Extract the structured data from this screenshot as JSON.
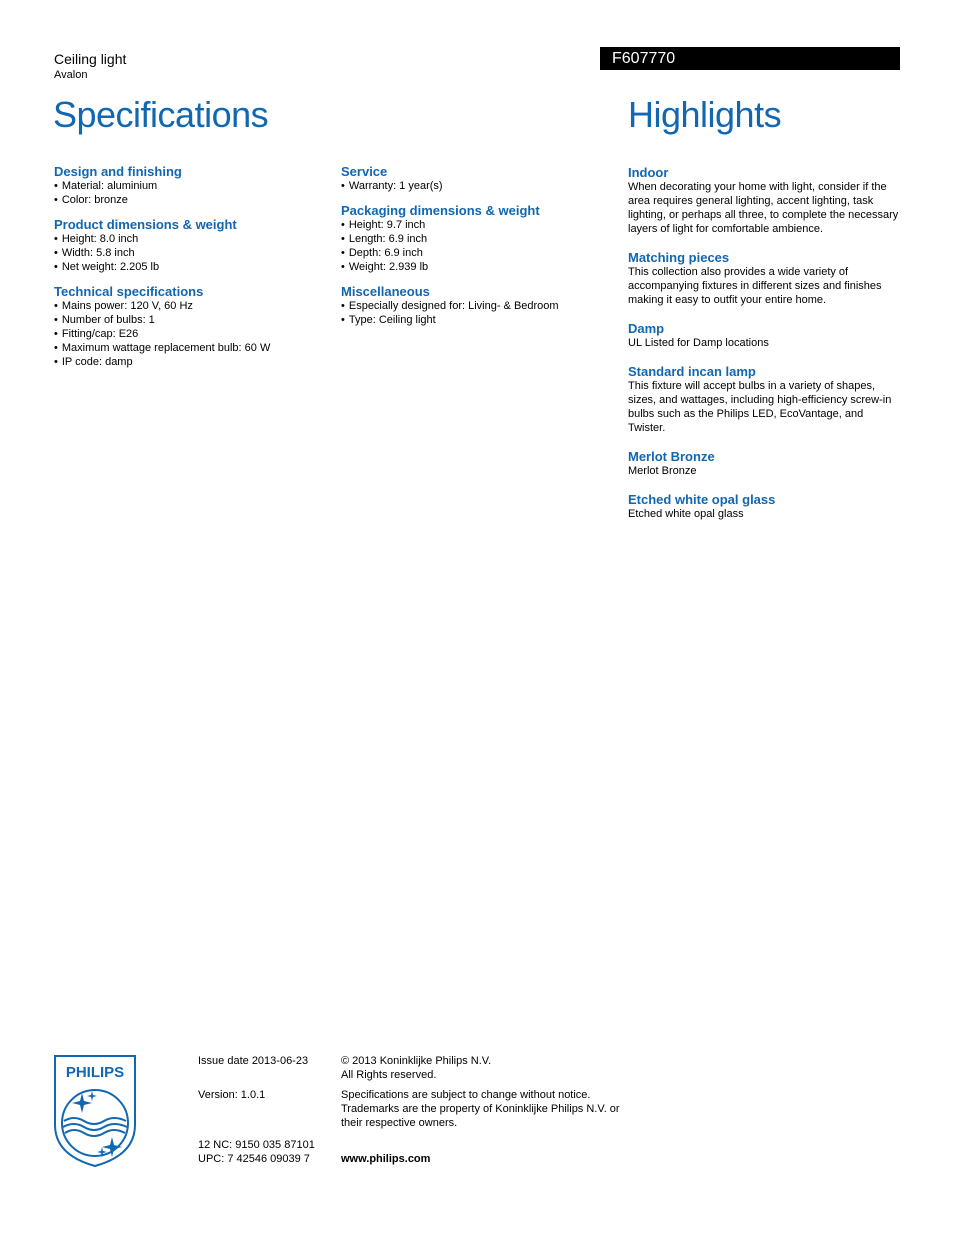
{
  "header": {
    "product_type": "Ceiling light",
    "product_family": "Avalon",
    "product_code": "F607770",
    "specs_title": "Specifications",
    "highlights_title": "Highlights"
  },
  "specifications": {
    "column1": [
      {
        "title": "Design and finishing",
        "items": [
          "Material: aluminium",
          "Color: bronze"
        ]
      },
      {
        "title": "Product dimensions & weight",
        "items": [
          "Height: 8.0 inch",
          "Width: 5.8 inch",
          "Net weight: 2.205 lb"
        ]
      },
      {
        "title": "Technical specifications",
        "items": [
          "Mains power: 120 V, 60 Hz",
          "Number of bulbs: 1",
          "Fitting/cap: E26",
          "Maximum wattage replacement bulb: 60 W",
          "IP code: damp"
        ]
      }
    ],
    "column2": [
      {
        "title": "Service",
        "items": [
          "Warranty: 1 year(s)"
        ]
      },
      {
        "title": "Packaging dimensions & weight",
        "items": [
          "Height: 9.7 inch",
          "Length: 6.9 inch",
          "Depth: 6.9 inch",
          "Weight: 2.939 lb"
        ]
      },
      {
        "title": "Miscellaneous",
        "items": [
          "Especially designed for: Living- & Bedroom",
          "Type: Ceiling light"
        ]
      }
    ]
  },
  "highlights": [
    {
      "title": "Indoor",
      "text": "When decorating your home with light, consider if the area requires general lighting, accent lighting, task lighting, or perhaps all three, to complete the necessary layers of light for comfortable ambience."
    },
    {
      "title": "Matching pieces",
      "text": "This collection also provides a wide variety of accompanying fixtures in different sizes and finishes making it easy to outfit your entire home."
    },
    {
      "title": "Damp",
      "text": "UL Listed for Damp locations"
    },
    {
      "title": "Standard incan lamp",
      "text": "This fixture will accept bulbs in a variety of shapes, sizes, and wattages, including high-efficiency screw-in bulbs such as the Philips LED, EcoVantage, and Twister."
    },
    {
      "title": "Merlot Bronze",
      "text": "Merlot Bronze"
    },
    {
      "title": "Etched white opal glass",
      "text": "Etched white opal glass"
    }
  ],
  "footer": {
    "logo_text": "PHILIPS",
    "issue_date": "Issue date 2013-06-23",
    "version": "Version: 1.0.1",
    "nc": "12 NC: 9150 035 87101",
    "upc": "UPC: 7 42546 09039 7",
    "copyright": "© 2013 Koninklijke Philips N.V.",
    "rights": "All Rights reserved.",
    "disclaimer": "Specifications are subject to change without notice. Trademarks are the property of Koninklijke Philips N.V. or their respective owners.",
    "website": "www.philips.com"
  },
  "colors": {
    "accent": "#1167b1",
    "code_bar": "#000000"
  }
}
